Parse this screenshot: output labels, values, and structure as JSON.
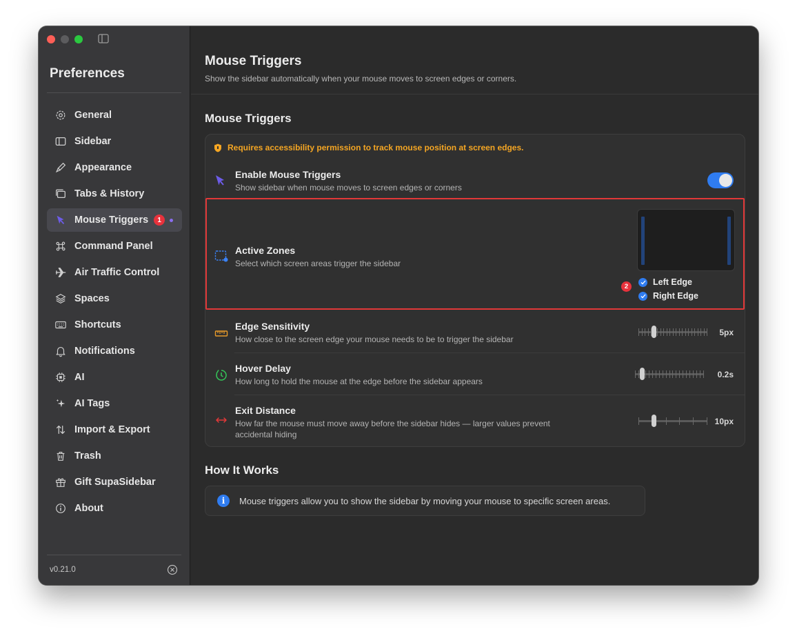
{
  "sidebar": {
    "title": "Preferences",
    "version": "v0.21.0",
    "items": [
      {
        "label": "General",
        "icon": "gear-icon"
      },
      {
        "label": "Sidebar",
        "icon": "sidebar-icon"
      },
      {
        "label": "Appearance",
        "icon": "paintbrush-icon"
      },
      {
        "label": "Tabs & History",
        "icon": "tabs-icon"
      },
      {
        "label": "Mouse Triggers",
        "icon": "cursor-icon",
        "active": true,
        "badge": "1"
      },
      {
        "label": "Command Panel",
        "icon": "command-icon"
      },
      {
        "label": "Air Traffic Control",
        "icon": "airplane-icon"
      },
      {
        "label": "Spaces",
        "icon": "layers-icon"
      },
      {
        "label": "Shortcuts",
        "icon": "keyboard-icon"
      },
      {
        "label": "Notifications",
        "icon": "bell-icon"
      },
      {
        "label": "AI",
        "icon": "chip-icon"
      },
      {
        "label": "AI Tags",
        "icon": "sparkles-icon"
      },
      {
        "label": "Import & Export",
        "icon": "arrows-updown-icon"
      },
      {
        "label": "Trash",
        "icon": "trash-icon"
      },
      {
        "label": "Gift SupaSidebar",
        "icon": "gift-icon"
      },
      {
        "label": "About",
        "icon": "info-icon"
      }
    ]
  },
  "main": {
    "title": "Mouse Triggers",
    "subtitle": "Show the sidebar automatically when your mouse moves to screen edges or corners.",
    "section_title": "Mouse Triggers",
    "warning": "Requires accessibility permission to track mouse position at screen edges.",
    "enable": {
      "title": "Enable Mouse Triggers",
      "desc": "Show sidebar when mouse moves to screen edges or corners",
      "on": true
    },
    "zones": {
      "title": "Active Zones",
      "desc": "Select which screen areas trigger the sidebar",
      "badge": "2",
      "left_label": "Left Edge",
      "right_label": "Right Edge",
      "left_checked": true,
      "right_checked": true
    },
    "sensitivity": {
      "title": "Edge Sensitivity",
      "desc": "How close to the screen edge your mouse needs to be to trigger the sidebar",
      "value": "5px",
      "position": 0.2
    },
    "hover": {
      "title": "Hover Delay",
      "desc": "How long to hold the mouse at the edge before the sidebar appears",
      "value": "0.2s",
      "position": 0.08
    },
    "exit": {
      "title": "Exit Distance",
      "desc": "How far the mouse must move away before the sidebar hides — larger values prevent accidental hiding",
      "value": "10px",
      "position": 0.2
    },
    "how_title": "How It Works",
    "how_text": "Mouse triggers allow you to show the sidebar by moving your mouse to specific screen areas."
  },
  "colors": {
    "accent": "#2f7cf0",
    "badge": "#e8323c",
    "warning": "#f5a623",
    "highlight": "#e23838"
  }
}
